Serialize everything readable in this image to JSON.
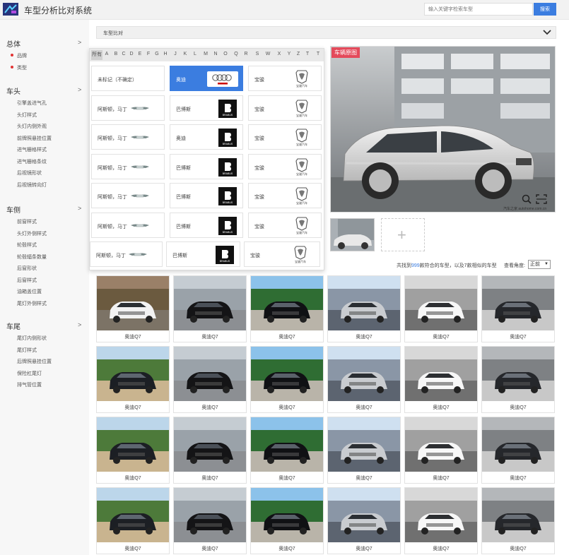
{
  "app": {
    "title": "车型分析比对系统"
  },
  "search": {
    "placeholder": "输入关键字检索车型",
    "button": "搜索"
  },
  "sidebar": {
    "sections": [
      {
        "label": "总体",
        "items": [
          "品牌",
          "类型"
        ]
      },
      {
        "label": "车头",
        "items": [
          "引擎盖进气孔",
          "头灯样式",
          "头灯内侧外观",
          "前牌照悬挂位置",
          "进气栅格样式",
          "进气栅格条纹",
          "后视镜形状",
          "后视镜转向灯"
        ]
      },
      {
        "label": "车侧",
        "items": [
          "前窗样式",
          "头灯外侧样式",
          "轮毂样式",
          "轮毂辐条数量",
          "后窗形状",
          "后窗样式",
          "油箱盖位置",
          "尾灯外侧样式"
        ]
      },
      {
        "label": "车尾",
        "items": [
          "尾灯内侧形状",
          "尾灯样式",
          "后牌照悬挂位置",
          "保险杠尾灯",
          "排气管位置"
        ]
      }
    ],
    "arrow": ">"
  },
  "bar": {
    "title": "车型比对"
  },
  "alphabet": [
    "所有",
    "A",
    "B",
    "C",
    "D",
    "E",
    "F",
    "G",
    "H",
    "J",
    "K",
    "L",
    "M",
    "N",
    "O",
    "Q",
    "R",
    "S",
    "W",
    "X",
    "Y",
    "Z",
    "T",
    "T"
  ],
  "brands": [
    [
      {
        "name": "未标记（不确定）",
        "logo": ""
      },
      {
        "name": "奥迪",
        "logo": "audi-logo",
        "selected": true
      },
      {
        "name": "宝骏",
        "logo": "baojun-logo"
      }
    ],
    [
      {
        "name": "阿斯顿，马丁",
        "logo": "aston-logo"
      },
      {
        "name": "巴博斯",
        "logo": "brabus-logo"
      },
      {
        "name": "宝骏",
        "logo": "baojun-logo"
      }
    ],
    [
      {
        "name": "阿斯顿，马丁",
        "logo": "aston-logo"
      },
      {
        "name": "奥迪",
        "logo": "brabus-logo"
      },
      {
        "name": "宝骏",
        "logo": "baojun-logo"
      }
    ],
    [
      {
        "name": "阿斯顿，马丁",
        "logo": "aston-logo"
      },
      {
        "name": "巴博斯",
        "logo": "brabus-logo"
      },
      {
        "name": "宝骏",
        "logo": "baojun-logo"
      }
    ],
    [
      {
        "name": "阿斯顿，马丁",
        "logo": "aston-logo"
      },
      {
        "name": "巴博斯",
        "logo": "brabus-logo"
      },
      {
        "name": "宝骏",
        "logo": "baojun-logo"
      }
    ],
    [
      {
        "name": "阿斯顿，马丁",
        "logo": "aston-logo"
      },
      {
        "name": "巴博斯",
        "logo": "brabus-logo"
      },
      {
        "name": "宝骏",
        "logo": "baojun-logo"
      }
    ],
    [
      {
        "name": "阿斯顿，马丁",
        "logo": "aston-logo"
      },
      {
        "name": "巴博斯",
        "logo": "brabus-logo"
      },
      {
        "name": "宝骏",
        "logo": "baojun-logo"
      }
    ]
  ],
  "brand_logo_text": {
    "brabus": "BRABUS",
    "baojun": "宝骏汽车"
  },
  "main_image": {
    "tag": "车辆原图",
    "caption": "汽车之家 autohome.com.cn"
  },
  "add_label": "+",
  "result": {
    "prefix": "共找到",
    "count": "999",
    "suffix": "款符合的车型，以及7款相似的车型"
  },
  "angle": {
    "label": "查看角度:",
    "value": "正前"
  },
  "grid": {
    "label": "奥迪Q7",
    "rows": [
      [
        "white-suv-autumn",
        "black-sedan-city",
        "black-sedan-palms",
        "silver-suv-mountain",
        "white-suv-street",
        "dark-sedan-building"
      ],
      [
        "black-suv-field",
        "black-sedan-city",
        "black-sedan-palms",
        "silver-suv-mountain",
        "white-suv-street",
        "dark-sedan-building"
      ],
      [
        "black-suv-field",
        "black-sedan-city",
        "black-sedan-palms",
        "silver-suv-mountain",
        "white-suv-street",
        "dark-sedan-building"
      ],
      [
        "black-suv-field",
        "black-sedan-city",
        "black-sedan-palms",
        "silver-suv-mountain",
        "white-suv-street",
        "dark-sedan-building"
      ]
    ]
  },
  "colors": {
    "accent": "#3b7de0",
    "tag": "#e44a5b",
    "dot": "#e23333"
  }
}
